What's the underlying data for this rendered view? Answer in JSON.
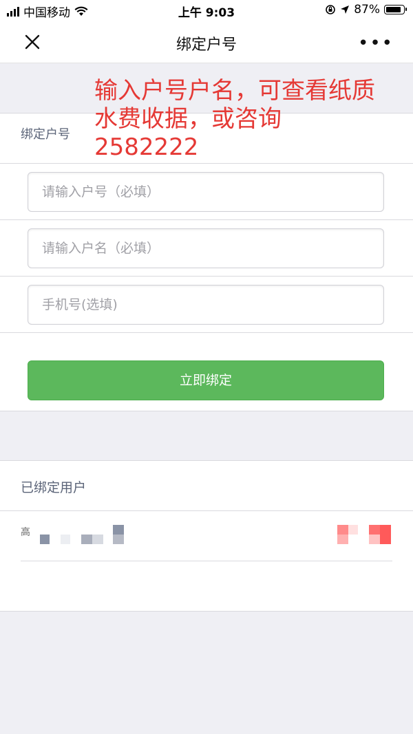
{
  "status_bar": {
    "carrier": "中国移动",
    "time": "上午 9:03",
    "battery_text": "87%"
  },
  "nav": {
    "title": "绑定户号",
    "close_icon": "close-icon",
    "more_icon": "more-icon"
  },
  "annotation": {
    "line1": "输入户号户名，可查看纸质",
    "line2": "水费收据，或咨询",
    "line3": "2582222",
    "color": "#e53935"
  },
  "form": {
    "header": "绑定户号",
    "account_placeholder": "请输入户号（必填）",
    "name_placeholder": "请输入户名（必填）",
    "phone_placeholder": "手机号(选填)",
    "submit_label": "立即绑定",
    "submit_color": "#5cb85c"
  },
  "bound": {
    "header": "已绑定用户",
    "users": [
      {
        "name": "高"
      }
    ]
  }
}
